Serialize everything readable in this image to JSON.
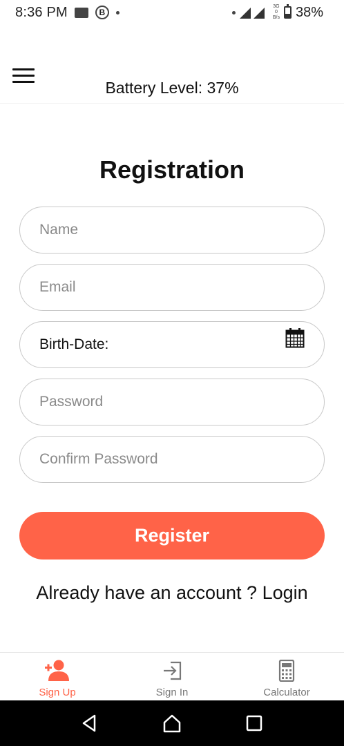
{
  "status_bar": {
    "time": "8:36 PM",
    "network": "3G",
    "net_speed_top": "0",
    "net_speed_bottom": "B/s",
    "battery_percent": "38%",
    "battery_level": 0.38
  },
  "header": {
    "battery_text": "Battery Level: 37%"
  },
  "form": {
    "title": "Registration",
    "name_placeholder": "Name",
    "email_placeholder": "Email",
    "birthdate_label": "Birth-Date:",
    "password_placeholder": "Password",
    "confirm_password_placeholder": "Confirm Password",
    "register_label": "Register",
    "login_prompt": "Already have an account ? Login"
  },
  "bottom_nav": {
    "items": [
      {
        "label": "Sign Up",
        "icon": "add-user-icon",
        "active": true
      },
      {
        "label": "Sign In",
        "icon": "sign-in-icon",
        "active": false
      },
      {
        "label": "Calculator",
        "icon": "calculator-icon",
        "active": false
      }
    ]
  },
  "colors": {
    "accent": "#ff6348",
    "border": "#c8c8c8",
    "inactive": "#777777"
  }
}
